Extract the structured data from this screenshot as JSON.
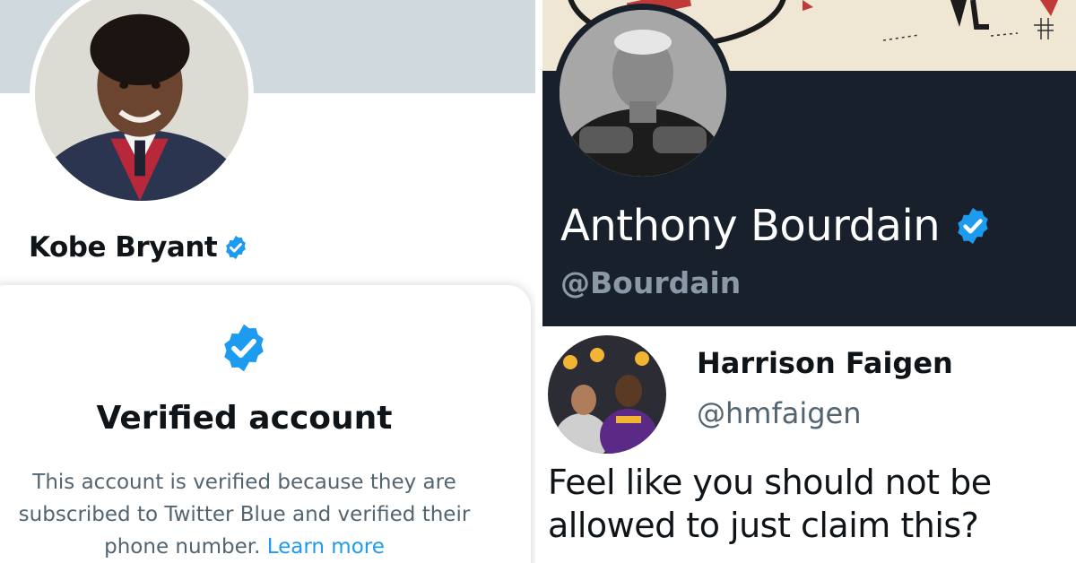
{
  "left_panel": {
    "profile": {
      "display_name": "Kobe Bryant",
      "verified_icon": "verified-badge-icon"
    },
    "verified_popup": {
      "icon": "verified-badge-icon",
      "title": "Verified account",
      "description": "This account is verified because they are subscribed to Twitter Blue and verified their phone number.",
      "learn_more_link": "Learn more"
    }
  },
  "right_top_panel": {
    "profile": {
      "display_name": "Anthony Bourdain",
      "handle": "@Bourdain",
      "verified_icon": "verified-badge-icon"
    }
  },
  "right_bottom_panel": {
    "tweet": {
      "author_name": "Harrison Faigen",
      "author_handle": "@hmfaigen",
      "text": "Feel like you should not be allowed to just claim this?"
    }
  },
  "colors": {
    "verified_blue": "#1d9bf0",
    "dark_background": "#17202b",
    "banner_gray": "#cfd9de",
    "secondary_text": "#536471",
    "dim_text_dark": "#8b98a5"
  }
}
